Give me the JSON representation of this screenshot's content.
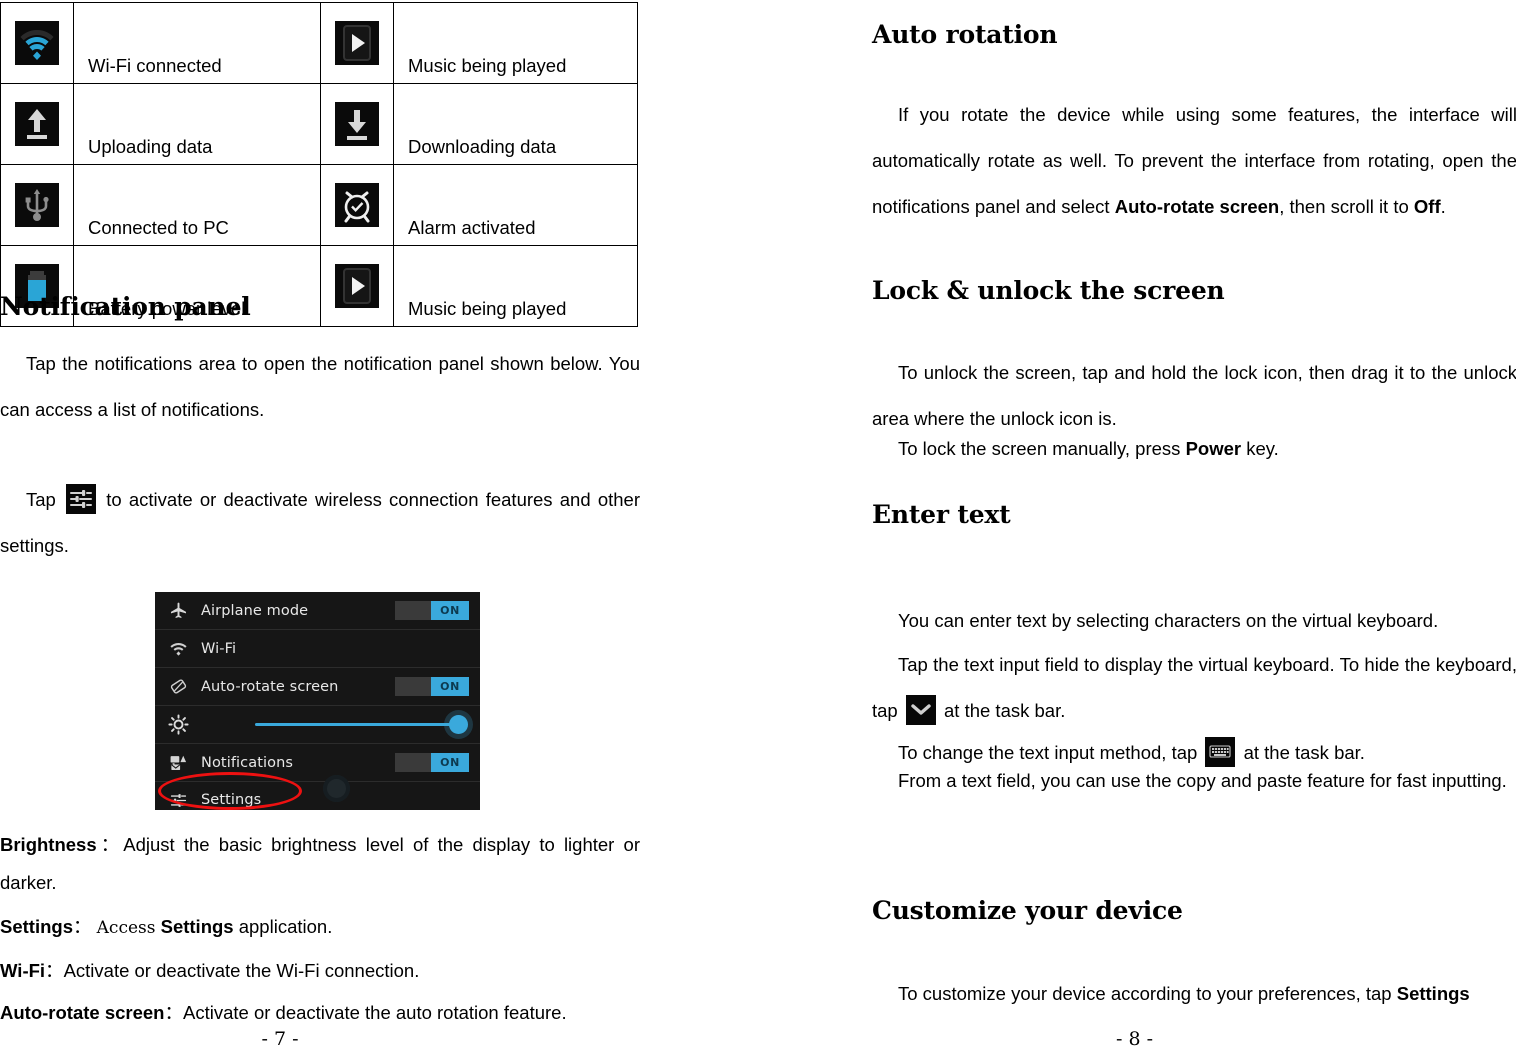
{
  "document": {
    "kind": "user-manual-spread"
  },
  "left_page": {
    "page_number": "- 7 -",
    "icon_table": {
      "rows": [
        {
          "icon_left": "wifi-icon",
          "label_left": "Wi-Fi connected",
          "icon_right": "play-icon",
          "label_right": "Music being played"
        },
        {
          "icon_left": "upload-icon",
          "label_left": "Uploading data",
          "icon_right": "download-icon",
          "label_right": "Downloading data"
        },
        {
          "icon_left": "usb-icon",
          "label_left": "Connected to PC",
          "icon_right": "alarm-icon",
          "label_right": "Alarm activated"
        },
        {
          "icon_left": "battery-icon",
          "label_left": "Battery power level",
          "icon_right": "play-icon",
          "label_right": "Music being played"
        }
      ]
    },
    "heading": "Notification panel",
    "para_1": "Tap the notifications area to open the notification panel shown below. You can access a list of notifications.",
    "para_2_before": "Tap",
    "para_2_after": "to activate or deactivate wireless connection features and other settings.",
    "para_2_icon": "settings-sliders-icon",
    "panel": {
      "rows": [
        {
          "icon": "airplane-icon",
          "label": "Airplane mode",
          "toggle": "ON"
        },
        {
          "icon": "wifi-icon",
          "label": "Wi-Fi",
          "toggle": ""
        },
        {
          "icon": "auto-rotate-icon",
          "label": "Auto-rotate screen",
          "toggle": "ON"
        },
        {
          "icon": "brightness-icon",
          "label": "",
          "toggle": ""
        },
        {
          "icon": "notifications-icon",
          "label": "Notifications",
          "toggle": "ON"
        },
        {
          "icon": "settings-sliders-icon",
          "label": "Settings",
          "toggle": ""
        }
      ],
      "highlight_color": "#ee1111",
      "accent_color": "#3aa9dc"
    },
    "definitions": [
      {
        "term": "Brightness",
        "colon": "：",
        "desc": "Adjust the basic brightness level of the display to lighter or darker."
      },
      {
        "term": "Settings",
        "colon": "：",
        "desc_pre": "Access",
        "desc_bold": "Settings",
        "desc_post": "application."
      },
      {
        "term": "Wi-Fi",
        "colon": "：",
        "desc": "Activate or deactivate the Wi-Fi connection."
      },
      {
        "term": "Auto-rotate screen",
        "colon": "：",
        "desc": "Activate or deactivate the auto rotation feature."
      }
    ]
  },
  "right_page": {
    "page_number": "- 8 -",
    "sections": [
      {
        "heading": "Auto rotation",
        "body_1": "If you rotate the device while using some features, the interface will automatically rotate as well. To prevent the interface from rotating, open the notifications panel and select ",
        "body_1_bold_a": "Auto-rotate screen",
        "body_1_mid": ", then scroll it to ",
        "body_1_bold_b": "Off",
        "body_1_end": "."
      },
      {
        "heading": "Lock & unlock the screen",
        "body_1": "To unlock the screen, tap and hold the lock icon, then drag it to the unlock area where the unlock icon is.",
        "body_2_pre": "To lock the screen manually, press ",
        "body_2_bold": "Power",
        "body_2_post": " key."
      },
      {
        "heading": "Enter text",
        "body_1": "You can enter text by selecting characters on the virtual keyboard.",
        "body_2_pre": "Tap the text input field to display the virtual keyboard. To hide the keyboard, tap",
        "body_2_icon": "hide-keyboard-icon",
        "body_2_post": "at the task bar.",
        "body_3_pre": "To change the text input method, tap",
        "body_3_icon": "keyboard-icon",
        "body_3_post": "at the task bar.",
        "body_4": "From a text field, you can use the copy and paste feature for fast inputting."
      },
      {
        "heading": "Customize your device",
        "body_1_pre": "To customize your device according to your preferences, tap ",
        "body_1_bold": "Settings"
      }
    ]
  }
}
